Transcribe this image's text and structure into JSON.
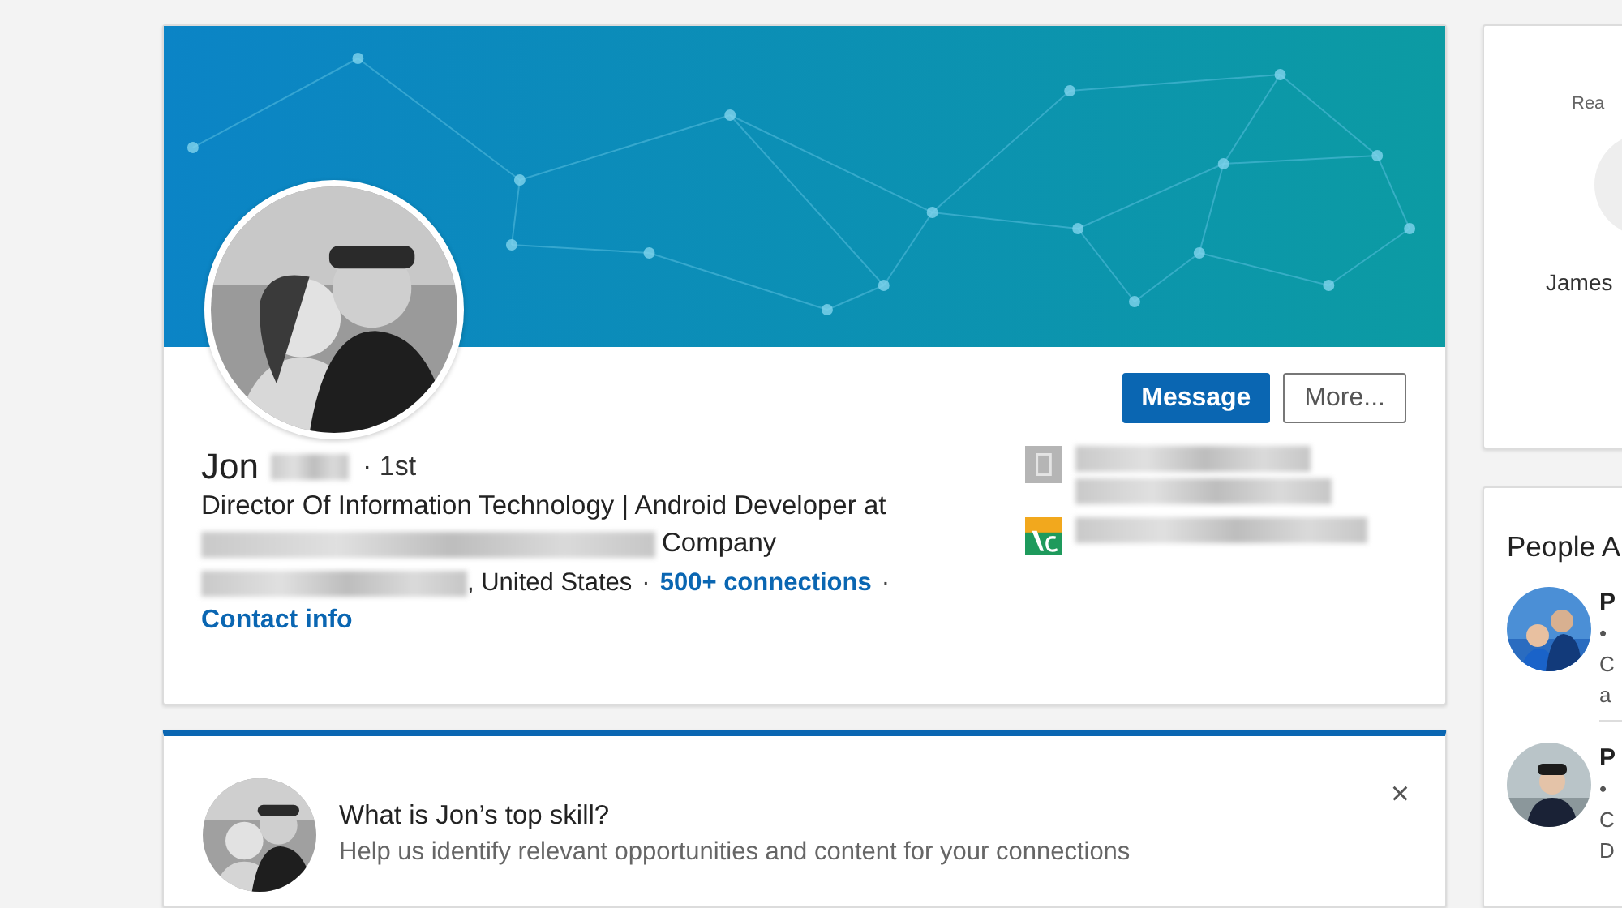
{
  "profile": {
    "name": "Jon",
    "degree": "· 1st",
    "headline": "Director Of Information Technology | Android Developer at",
    "headline_end": "Company",
    "location_end": ", United States",
    "separator": "·",
    "connections": "500+ connections",
    "trailing": "·",
    "contact": "Contact info"
  },
  "buttons": [
    {
      "label": "Message",
      "kind": "primary"
    },
    {
      "label": "More...",
      "kind": "secondary"
    }
  ],
  "experience": [
    {
      "kind": "company"
    },
    {
      "kind": "school"
    }
  ],
  "skill_card": {
    "title": "What is Jon’s top skill?",
    "subtitle": "Help us identify relevant opportunities and content for your connections",
    "close": "×"
  },
  "sidebar": {
    "card_label": "Rea",
    "card_name": "James",
    "people_title": "People A",
    "people": [
      {
        "name": "P",
        "lines": [
          "•",
          "C",
          "a"
        ]
      },
      {
        "name": "P",
        "lines": [
          "•",
          "C",
          "D"
        ]
      }
    ]
  }
}
